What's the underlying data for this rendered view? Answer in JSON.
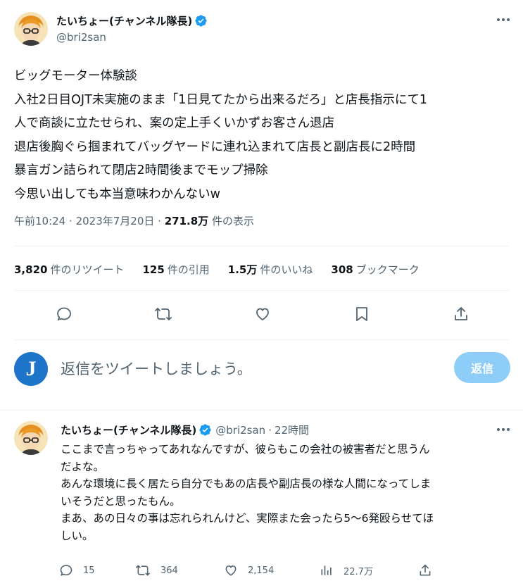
{
  "main_tweet": {
    "author_name": "たいちょー(チャンネル隊長)",
    "author_handle": "@bri2san",
    "verified": true,
    "lines": [
      "ビッグモーター体験談",
      "入社2日目OJT未実施のまま「1日見てたから出来るだろ」と店長指示にて1",
      "人で商談に立たせられ、案の定上手くいかずお客さん退店",
      "退店後胸ぐら掴まれてバッグヤードに連れ込まれて店長と副店長に2時間",
      "暴言ガン詰られて閉店2時間後までモップ掃除",
      "今思い出しても本当意味わかんないw"
    ],
    "time": "午前10:24",
    "date": "2023年7月20日",
    "views_count": "271.8万",
    "views_label": "件の表示",
    "separator": "·"
  },
  "stats": [
    {
      "count": "3,820",
      "label": "件のリツイート"
    },
    {
      "count": "125",
      "label": "件の引用"
    },
    {
      "count": "1.5万",
      "label": "件のいいね"
    },
    {
      "count": "308",
      "label": "ブックマーク"
    }
  ],
  "compose": {
    "placeholder": "返信をツイートしましょう。",
    "reply_button": "返信",
    "avatar_letter": "J"
  },
  "reply_tweet": {
    "author_name": "たいちょー(チャンネル隊長)",
    "author_handle": "@bri2san",
    "separator": "·",
    "time_ago": "22時間",
    "lines": [
      "ここまで言っちゃってあれなんですが、彼らもこの会社の被害者だと思うん",
      "だよな。",
      "あんな環境に長く居たら自分でもあの店長や副店長の様な人間になってしま",
      "いそうだと思ったもん。",
      "まあ、あの日々の事は忘れられんけど、実際また会ったら5〜6発殴らせてほ",
      "しい。"
    ],
    "replies": "15",
    "retweets": "364",
    "likes": "2,154",
    "views": "22.7万"
  },
  "colors": {
    "text_primary": "#0f1419",
    "text_secondary": "#536471",
    "verified_badge": "#1d9bf0",
    "reply_button_bg": "#8ecdf8",
    "divider": "#eff3f4"
  },
  "icons": [
    "verified-badge-icon",
    "more-icon",
    "reply-icon",
    "retweet-icon",
    "like-icon",
    "bookmark-icon",
    "share-icon",
    "views-icon"
  ]
}
